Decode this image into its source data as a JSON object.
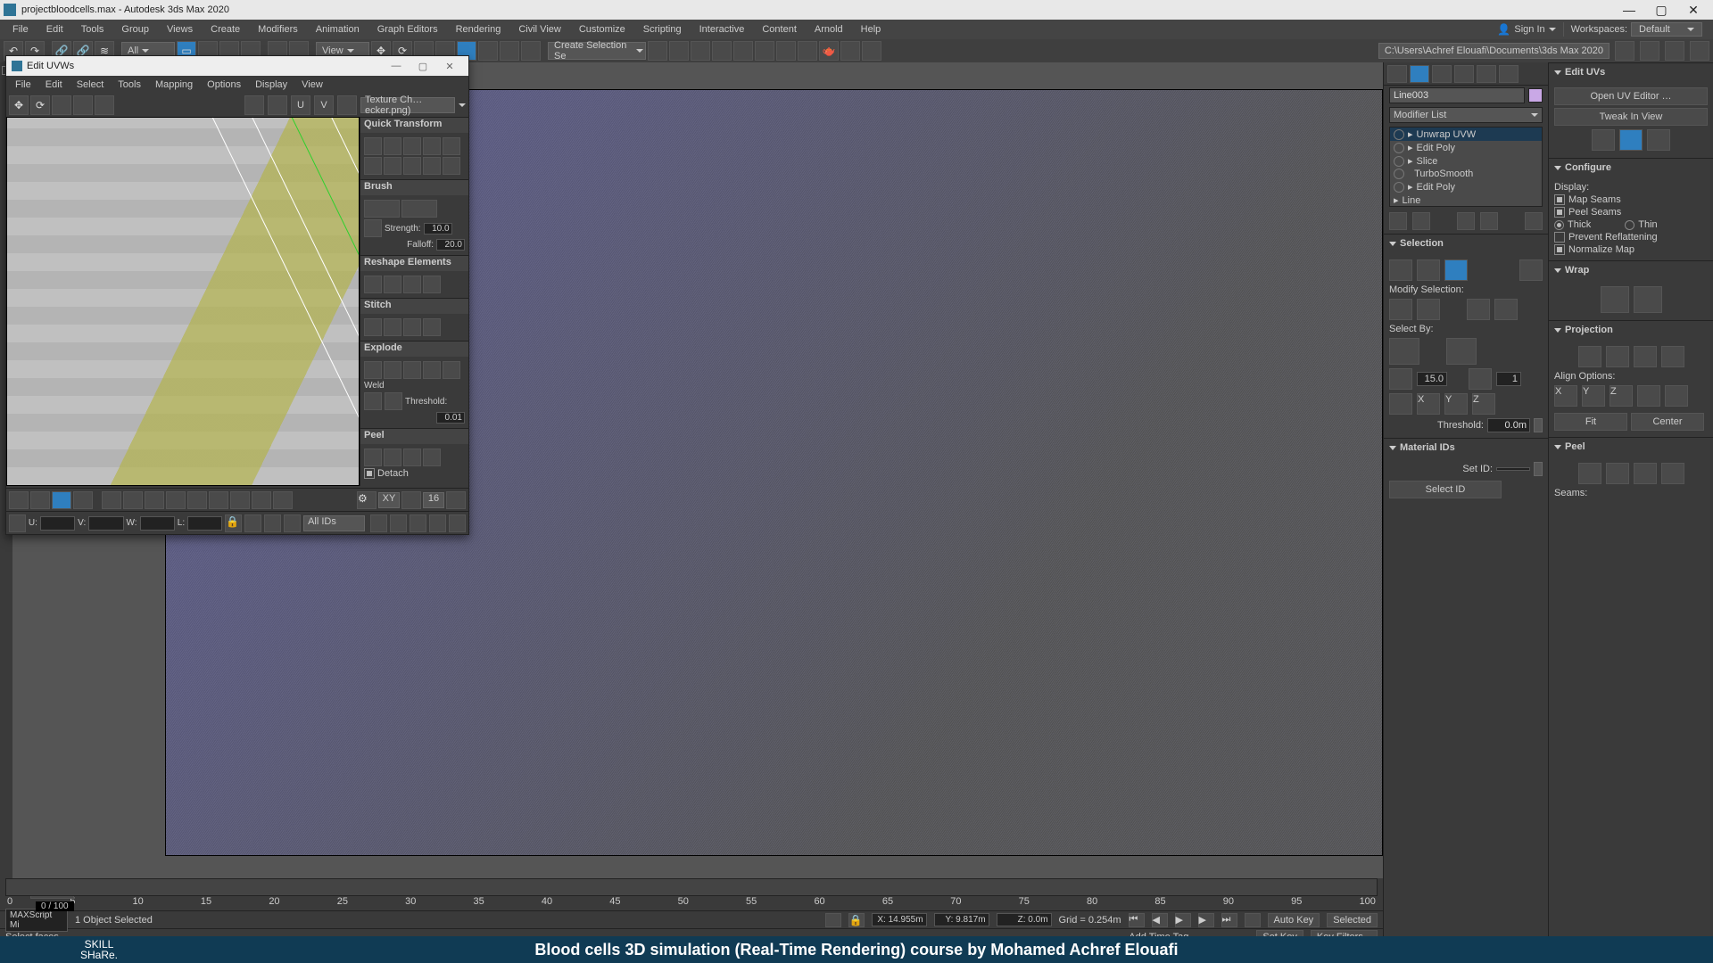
{
  "app": {
    "title": "projectbloodcells.max - Autodesk 3ds Max 2020",
    "sign_in": "Sign In",
    "workspaces_label": "Workspaces:",
    "workspaces_value": "Default",
    "project_path": "C:\\Users\\Achref Elouafi\\Documents\\3ds Max 2020"
  },
  "main_menu": [
    "File",
    "Edit",
    "Tools",
    "Group",
    "Views",
    "Create",
    "Modifiers",
    "Animation",
    "Graph Editors",
    "Rendering",
    "Civil View",
    "Customize",
    "Scripting",
    "Interactive",
    "Content",
    "Arnold",
    "Help"
  ],
  "main_toolbar": {
    "all_filter": "All",
    "view_label": "View",
    "create_selection": "Create Selection Se"
  },
  "uv_dialog": {
    "title": "Edit UVWs",
    "menu": [
      "File",
      "Edit",
      "Select",
      "Tools",
      "Mapping",
      "Options",
      "Display",
      "View"
    ],
    "checker_dd": "Texture Ch…ecker.png)",
    "quick_transform": "Quick Transform",
    "brush": {
      "title": "Brush",
      "strength_label": "Strength:",
      "strength_value": "10.0",
      "falloff_label": "Falloff:",
      "falloff_value": "20.0"
    },
    "reshape": "Reshape Elements",
    "stitch": "Stitch",
    "explode": {
      "title": "Explode",
      "weld_label": "Weld",
      "threshold_label": "Threshold:",
      "threshold_value": "0.01"
    },
    "peel": {
      "title": "Peel",
      "detach": "Detach"
    },
    "bottom": {
      "xy_label": "XY",
      "spinner": "16",
      "u_label": "U:",
      "v_label": "V:",
      "w_label": "W:",
      "l_label": "L:",
      "all_ids": "All IDs"
    }
  },
  "command_panel": {
    "object_name": "Line003",
    "modifier_list_label": "Modifier List",
    "modifiers": [
      "Unwrap UVW",
      "Edit Poly",
      "Slice",
      "TurboSmooth",
      "Edit Poly",
      "Line"
    ],
    "selected_modifier_index": 0,
    "selection": {
      "title": "Selection",
      "modify_label": "Modify Selection:",
      "select_by_label": "Select By:",
      "spinner1": "15.0",
      "spinner2": "1",
      "xyz": [
        "X",
        "Y",
        "Z"
      ],
      "threshold_label": "Threshold:",
      "threshold_value": "0.0m"
    },
    "material_ids": {
      "title": "Material IDs",
      "set_id_label": "Set ID:",
      "select_id_label": "Select ID"
    },
    "edit_uvs": {
      "title": "Edit UVs",
      "open_editor": "Open UV Editor …",
      "tweak": "Tweak In View"
    },
    "configure": {
      "title": "Configure",
      "display_label": "Display:",
      "map_seams": "Map Seams",
      "peel_seams": "Peel Seams",
      "thick": "Thick",
      "thin": "Thin",
      "prevent_reflat": "Prevent Reflattening",
      "normalize_map": "Normalize Map"
    },
    "wrap": {
      "title": "Wrap"
    },
    "projection": {
      "title": "Projection",
      "align_label": "Align Options:",
      "fit": "Fit",
      "center": "Center"
    },
    "peel": {
      "title": "Peel",
      "seams_label": "Seams:"
    }
  },
  "time": {
    "default_btn": "Default",
    "current": "0 / 100",
    "ticks": [
      "0",
      "5",
      "10",
      "15",
      "20",
      "25",
      "30",
      "35",
      "40",
      "45",
      "50",
      "55",
      "60",
      "65",
      "70",
      "75",
      "80",
      "85",
      "90",
      "95",
      "100"
    ]
  },
  "status": {
    "selected": "1 Object Selected",
    "x": "X: 14.955m",
    "y": "Y: 9.817m",
    "z": "Z: 0.0m",
    "grid": "Grid = 0.254m",
    "auto_key": "Auto Key",
    "set_key": "Set Key",
    "selected_kf": "Selected",
    "key_filters": "Key Filters...",
    "add_time_tag": "Add Time Tag",
    "script_label": "MAXScript Mi",
    "prompt": "Select faces"
  },
  "caption": {
    "skill": "SKILL\nSHaRe.",
    "text": "Blood cells 3D simulation (Real-Time Rendering) course by Mohamed Achref Elouafi"
  }
}
